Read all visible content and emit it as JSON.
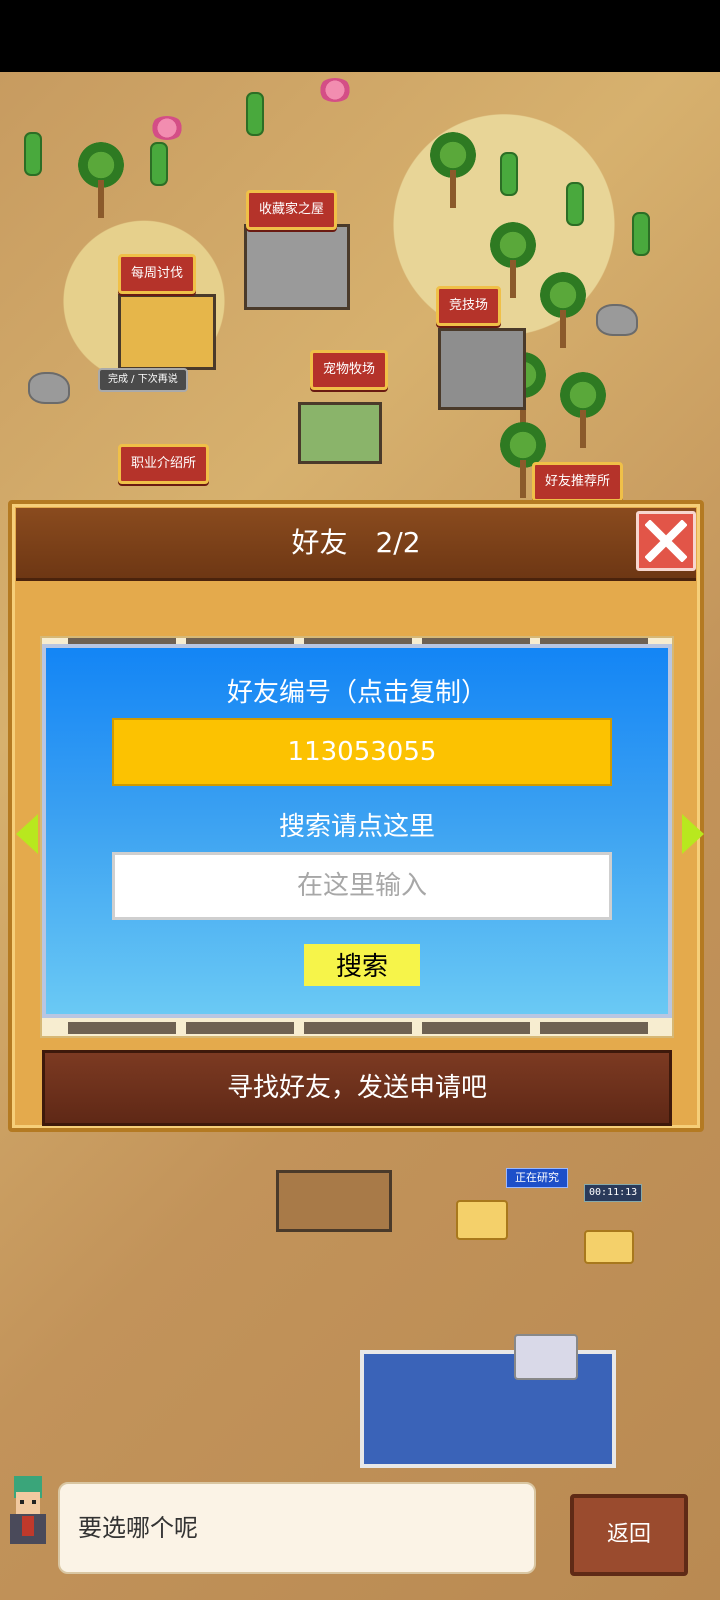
{
  "map": {
    "signs": [
      "收藏家之屋",
      "每周讨伐",
      "竞技场",
      "宠物牧场",
      "职业介绍所",
      "好友推荐所"
    ],
    "status_tag": "完成 / 下次再说",
    "research_tag": "正在研究",
    "research_timer": "00:11:13"
  },
  "modal": {
    "title": "好友",
    "count": "2/2",
    "friend_id_label": "好友编号（点击复制）",
    "friend_id": "113053055",
    "search_label": "搜索请点这里",
    "search_placeholder": "在这里输入",
    "search_button": "搜索",
    "hint": "寻找好友，发送申请吧"
  },
  "dialogue": {
    "text": "要选哪个呢",
    "back_button": "返回"
  },
  "colors": {
    "panel_blue": "#1385f5",
    "id_box": "#fcc201",
    "search_button": "#f6f44a",
    "close_button": "#e25548",
    "header_brown": "#7c3a22"
  }
}
